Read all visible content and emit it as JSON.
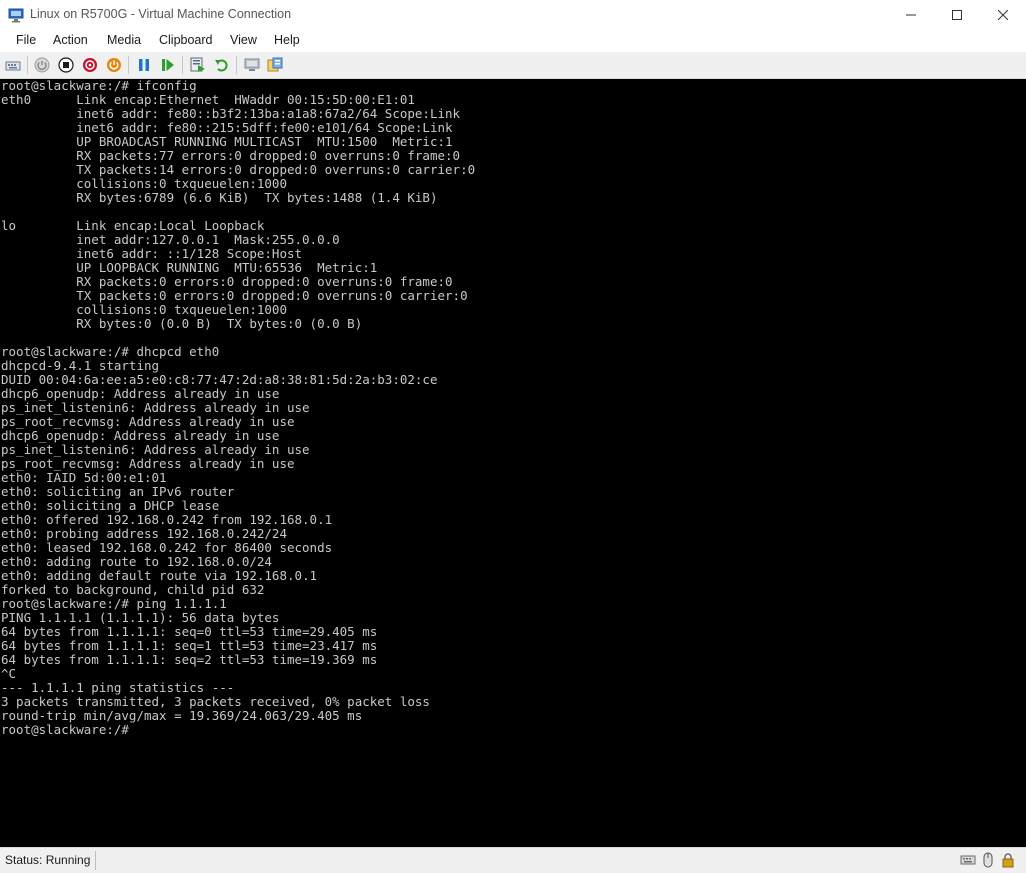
{
  "window": {
    "title": "Linux on R5700G - Virtual Machine Connection"
  },
  "menu": [
    {
      "label": "File"
    },
    {
      "label": "Action"
    },
    {
      "label": "Media"
    },
    {
      "label": "Clipboard"
    },
    {
      "label": "View"
    },
    {
      "label": "Help"
    }
  ],
  "toolbar": {
    "icons": [
      "ctrl-alt-del-icon",
      "start-icon",
      "turn-off-icon",
      "shut-down-icon",
      "save-icon",
      "pause-icon",
      "resume-icon",
      "checkpoint-icon",
      "revert-icon",
      "enhanced-session-icon",
      "share-icon"
    ],
    "colors": {
      "turn_off": "#c8102e",
      "shut_down": "#e8830c",
      "pause": "#1e73d8",
      "resume": "#2e9e2e"
    }
  },
  "console": {
    "lines": [
      "root@slackware:/# ifconfig",
      "eth0      Link encap:Ethernet  HWaddr 00:15:5D:00:E1:01",
      "          inet6 addr: fe80::b3f2:13ba:a1a8:67a2/64 Scope:Link",
      "          inet6 addr: fe80::215:5dff:fe00:e101/64 Scope:Link",
      "          UP BROADCAST RUNNING MULTICAST  MTU:1500  Metric:1",
      "          RX packets:77 errors:0 dropped:0 overruns:0 frame:0",
      "          TX packets:14 errors:0 dropped:0 overruns:0 carrier:0",
      "          collisions:0 txqueuelen:1000",
      "          RX bytes:6789 (6.6 KiB)  TX bytes:1488 (1.4 KiB)",
      "",
      "lo        Link encap:Local Loopback",
      "          inet addr:127.0.0.1  Mask:255.0.0.0",
      "          inet6 addr: ::1/128 Scope:Host",
      "          UP LOOPBACK RUNNING  MTU:65536  Metric:1",
      "          RX packets:0 errors:0 dropped:0 overruns:0 frame:0",
      "          TX packets:0 errors:0 dropped:0 overruns:0 carrier:0",
      "          collisions:0 txqueuelen:1000",
      "          RX bytes:0 (0.0 B)  TX bytes:0 (0.0 B)",
      "",
      "root@slackware:/# dhcpcd eth0",
      "dhcpcd-9.4.1 starting",
      "DUID 00:04:6a:ee:a5:e0:c8:77:47:2d:a8:38:81:5d:2a:b3:02:ce",
      "dhcp6_openudp: Address already in use",
      "ps_inet_listenin6: Address already in use",
      "ps_root_recvmsg: Address already in use",
      "dhcp6_openudp: Address already in use",
      "ps_inet_listenin6: Address already in use",
      "ps_root_recvmsg: Address already in use",
      "eth0: IAID 5d:00:e1:01",
      "eth0: soliciting an IPv6 router",
      "eth0: soliciting a DHCP lease",
      "eth0: offered 192.168.0.242 from 192.168.0.1",
      "eth0: probing address 192.168.0.242/24",
      "eth0: leased 192.168.0.242 for 86400 seconds",
      "eth0: adding route to 192.168.0.0/24",
      "eth0: adding default route via 192.168.0.1",
      "forked to background, child pid 632",
      "root@slackware:/# ping 1.1.1.1",
      "PING 1.1.1.1 (1.1.1.1): 56 data bytes",
      "64 bytes from 1.1.1.1: seq=0 ttl=53 time=29.405 ms",
      "64 bytes from 1.1.1.1: seq=1 ttl=53 time=23.417 ms",
      "64 bytes from 1.1.1.1: seq=2 ttl=53 time=19.369 ms",
      "^C",
      "--- 1.1.1.1 ping statistics ---",
      "3 packets transmitted, 3 packets received, 0% packet loss",
      "round-trip min/avg/max = 19.369/24.063/29.405 ms",
      "root@slackware:/#"
    ]
  },
  "status": {
    "text": "Status: Running",
    "tray_icons": [
      "keyboard-icon",
      "mouse-icon",
      "lock-icon"
    ]
  }
}
